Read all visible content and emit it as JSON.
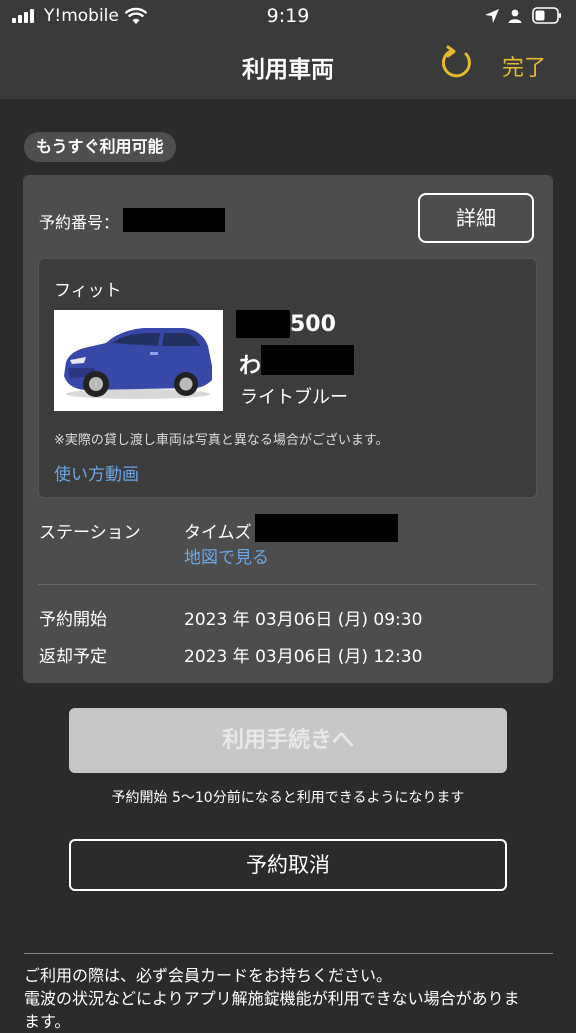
{
  "status_bar": {
    "carrier": "Y!mobile",
    "time": "9:19"
  },
  "nav": {
    "title": "利用車両",
    "done_label": "完了",
    "accent_color": "#e8b92d"
  },
  "badge": "もうすぐ利用可能",
  "reservation": {
    "number_label": "予約番号：",
    "details_button": "詳細"
  },
  "vehicle": {
    "model": "フィット",
    "plate_number_suffix": "500",
    "plate_hiragana": "わ",
    "color": "ライトブルー",
    "note": "※実際の貸し渡し車両は写真と異なる場合がございます。",
    "howto_link": "使い方動画"
  },
  "station": {
    "label": "ステーション",
    "name": "タイムズ",
    "map_link": "地図で見る"
  },
  "schedule": {
    "start_label": "予約開始",
    "start_value": "2023 年 03月06日 (月) 09:30",
    "return_label": "返却予定",
    "return_value": "2023 年 03月06日 (月) 12:30"
  },
  "actions": {
    "proceed_button": "利用手続きへ",
    "proceed_note": "予約開始 5〜10分前になると利用できるようになります",
    "cancel_button": "予約取消"
  },
  "footer": {
    "line1": "ご利用の際は、必ず会員カードをお持ちください。",
    "line2": "電波の状況などによりアプリ解施錠機能が利用できない場合がありま",
    "line3": "ます。"
  }
}
